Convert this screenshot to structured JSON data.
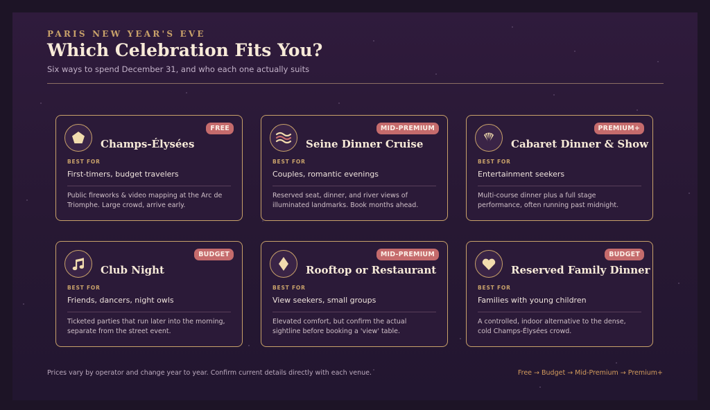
{
  "header": {
    "eyebrow": "PARIS NEW YEAR'S EVE",
    "title": "Which Celebration Fits You?",
    "subtitle": "Six ways to spend December 31, and who each one actually suits"
  },
  "best_for_label": "BEST FOR",
  "cards": [
    {
      "title": "Champs-Élysées",
      "badge": "FREE",
      "icon": "pentagon-icon",
      "best_for": "First-timers, budget travelers",
      "description": "Public fireworks & video mapping at the Arc de Triomphe. Large crowd, arrive early."
    },
    {
      "title": "Seine Dinner Cruise",
      "badge": "MID-PREMIUM",
      "icon": "waves-icon",
      "best_for": "Couples, romantic evenings",
      "description": "Reserved seat, dinner, and river views of illuminated landmarks. Book months ahead."
    },
    {
      "title": "Cabaret Dinner & Show",
      "badge": "PREMIUM+",
      "icon": "fan-icon",
      "best_for": "Entertainment seekers",
      "description": "Multi-course dinner plus a full stage performance, often running past midnight."
    },
    {
      "title": "Club Night",
      "badge": "BUDGET",
      "icon": "music-note-icon",
      "best_for": "Friends, dancers, night owls",
      "description": "Ticketed parties that run later into the morning, separate from the street event."
    },
    {
      "title": "Rooftop or Restaurant",
      "badge": "MID-PREMIUM",
      "icon": "diamond-icon",
      "best_for": "View seekers, small groups",
      "description": "Elevated comfort, but confirm the actual sightline before booking a 'view' table."
    },
    {
      "title": "Reserved Family Dinner",
      "badge": "BUDGET",
      "icon": "heart-icon",
      "best_for": "Families with young children",
      "description": "A controlled, indoor alternative to the dense, cold Champs-Élysées crowd."
    }
  ],
  "footer": {
    "note": "Prices vary by operator and change year to year. Confirm current details directly with each venue.",
    "legend": "Free → Budget → Mid-Premium → Premium+"
  },
  "colors": {
    "accent_gold": "#c9a26a",
    "badge": "#c56b6c",
    "background": "#2f1b3c"
  }
}
